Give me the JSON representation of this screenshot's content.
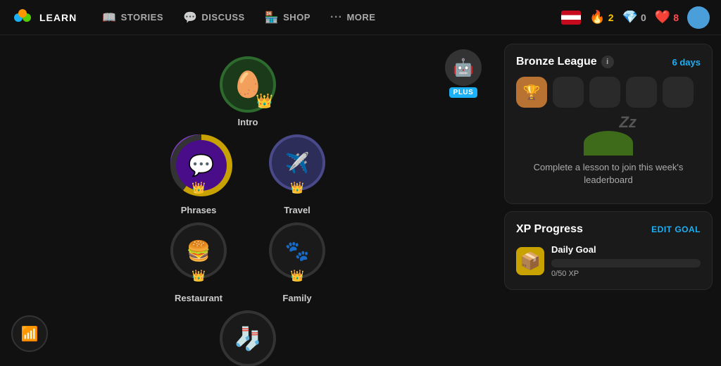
{
  "nav": {
    "brand": "LEARN",
    "items": [
      {
        "id": "learn",
        "label": "LEARN",
        "active": true,
        "icon": "🦉"
      },
      {
        "id": "stories",
        "label": "STORIES",
        "active": false,
        "icon": "📖"
      },
      {
        "id": "discuss",
        "label": "DISCUSS",
        "active": false,
        "icon": "💬"
      },
      {
        "id": "shop",
        "label": "SHOP",
        "active": false,
        "icon": "🏪"
      },
      {
        "id": "more",
        "label": "MORE",
        "active": false,
        "icon": "···"
      }
    ],
    "streak": "2",
    "gems": "0",
    "hearts": "8"
  },
  "plus": {
    "badge": "PLUS"
  },
  "units": [
    {
      "id": "intro",
      "label": "Intro",
      "row": 0,
      "icon": "🥚",
      "type": "intro",
      "has_crown": true
    },
    {
      "id": "phrases",
      "label": "Phrases",
      "row": 1,
      "icon": "💬",
      "type": "phrases",
      "has_crown": true
    },
    {
      "id": "travel",
      "label": "Travel",
      "row": 1,
      "icon": "✈️",
      "type": "travel",
      "has_crown": true
    },
    {
      "id": "restaurant",
      "label": "Restaurant",
      "row": 2,
      "icon": "🍔",
      "type": "restaurant",
      "has_crown": true
    },
    {
      "id": "family",
      "label": "Family",
      "row": 2,
      "icon": "🐾",
      "type": "family",
      "has_crown": true
    },
    {
      "id": "bottom",
      "label": "",
      "row": 3,
      "icon": "🧦",
      "type": "bottom",
      "has_crown": false
    }
  ],
  "league": {
    "title": "Bronze League",
    "days_label": "6 days",
    "info_label": "i"
  },
  "leaderboard": {
    "sleep_text": "Complete a lesson to join this week's\nleaderboard"
  },
  "xp_progress": {
    "title": "XP Progress",
    "edit_goal": "EDIT GOAL",
    "daily_goal_label": "Daily Goal",
    "xp_count": "0/50 XP",
    "fill_pct": 0
  }
}
